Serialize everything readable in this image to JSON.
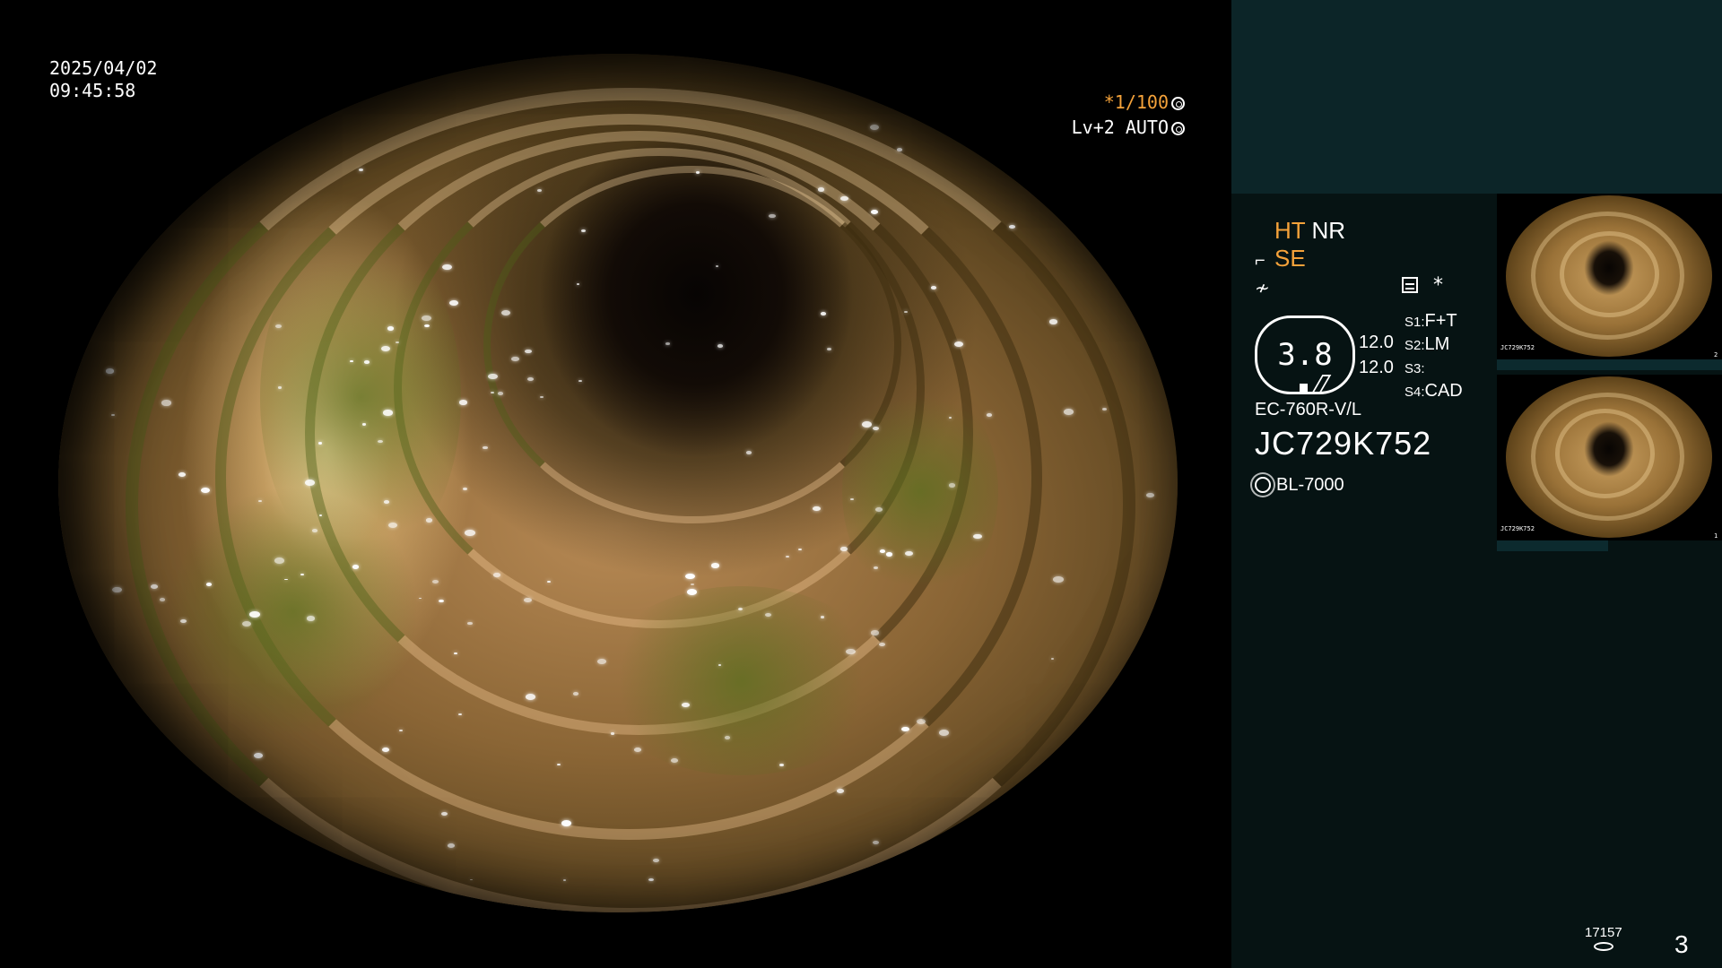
{
  "overlay": {
    "date": "2025/04/02",
    "time": "09:45:58",
    "shutter_prefix": "*1/100",
    "level": "Lv+2",
    "iris": "AUTO"
  },
  "panel": {
    "mode_ht": "HT",
    "mode_nr": "NR",
    "mode_se": "SE",
    "struct_symbol": "*",
    "zoom_value": "3.8",
    "gauge_val_1": "12.0",
    "gauge_val_2": "12.0",
    "switches": [
      {
        "key": "S1:",
        "value": "F+T"
      },
      {
        "key": "S2:",
        "value": "LM"
      },
      {
        "key": "S3:",
        "value": ""
      },
      {
        "key": "S4:",
        "value": "CAD"
      }
    ],
    "scope_model": "EC-760R-V/L",
    "scope_serial": "JC729K752",
    "light_source": "BL-7000"
  },
  "thumbnails": [
    {
      "serial": "JC729K752",
      "index": "2"
    },
    {
      "serial": "JC729K752",
      "index": "1"
    }
  ],
  "footer": {
    "storage_count": "17157",
    "page_number": "3"
  },
  "colors": {
    "accent_orange": "#f4a23a",
    "panel_bg": "#061313",
    "panel_top_bg": "#0c2528"
  },
  "icons": {
    "shutter": "aperture-icon",
    "iris": "iris-icon",
    "scope_angle": "scope-angle-icon",
    "freeze": "freeze-icon",
    "structure": "structure-enhance-icon",
    "light": "light-source-icon",
    "storage": "storage-disk-icon"
  }
}
